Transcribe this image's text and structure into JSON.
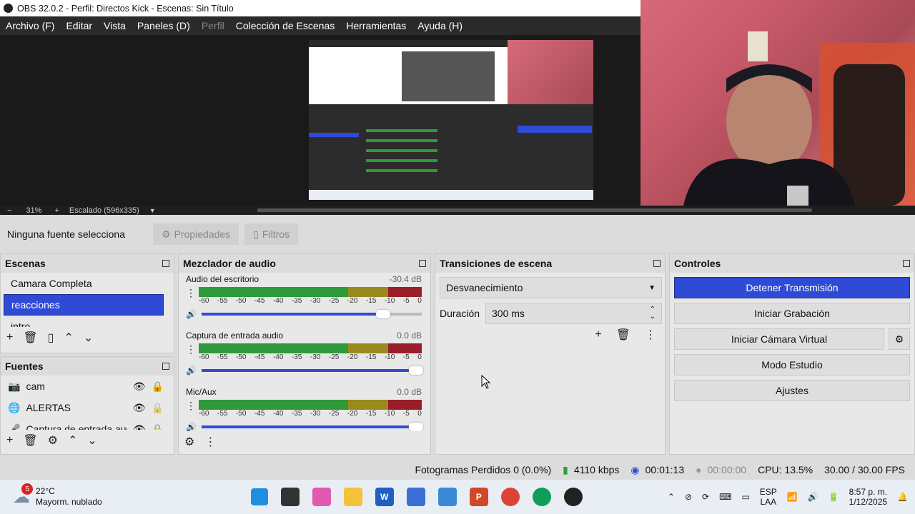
{
  "window": {
    "title": "OBS 32.0.2 - Perfil: Directos Kick - Escenas: Sin Título"
  },
  "menu": [
    {
      "label": "Archivo (F)",
      "disabled": false
    },
    {
      "label": "Editar",
      "disabled": false
    },
    {
      "label": "Vista",
      "disabled": false
    },
    {
      "label": "Paneles (D)",
      "disabled": false
    },
    {
      "label": "Perfil",
      "disabled": true
    },
    {
      "label": "Colección de Escenas",
      "disabled": false
    },
    {
      "label": "Herramientas",
      "disabled": false
    },
    {
      "label": "Ayuda (H)",
      "disabled": false
    }
  ],
  "zoom": {
    "minus": "−",
    "percent": "31%",
    "plus": "+",
    "scaling": "Escalado (596x335)"
  },
  "source_toolbar": {
    "no_source": "Ninguna fuente selecciona",
    "properties": "Propiedades",
    "filters": "Filtros"
  },
  "scenes": {
    "title": "Escenas",
    "items": [
      {
        "label": "Camara Completa",
        "selected": false
      },
      {
        "label": "reacciones",
        "selected": true
      },
      {
        "label": "intro",
        "selected": false
      }
    ]
  },
  "sources": {
    "title": "Fuentes",
    "items": [
      {
        "label": "cam",
        "icon": "camera-icon"
      },
      {
        "label": "ALERTAS",
        "icon": "globe-icon"
      },
      {
        "label": "Captura de entrada aud",
        "icon": "mic-icon"
      }
    ]
  },
  "mixer": {
    "title": "Mezclador de audio",
    "scale": [
      "-60",
      "-55",
      "-50",
      "-45",
      "-40",
      "-35",
      "-30",
      "-25",
      "-20",
      "-15",
      "-10",
      "-5",
      "0"
    ],
    "channels": [
      {
        "name": "Audio del escritorio",
        "db": "-30.4 dB",
        "volume": 0.85
      },
      {
        "name": "Captura de entrada audio",
        "db": "0.0 dB",
        "volume": 1.0
      },
      {
        "name": "Mic/Aux",
        "db": "0.0 dB",
        "volume": 1.0
      }
    ]
  },
  "transitions": {
    "title": "Transiciones de escena",
    "selected": "Desvanecimiento",
    "duration_label": "Duración",
    "duration_value": "300 ms"
  },
  "controls": {
    "title": "Controles",
    "buttons": {
      "stop_stream": "Detener Transmisión",
      "start_record": "Iniciar Grabación",
      "start_vcam": "Iniciar Cámara Virtual",
      "studio": "Modo Estudio",
      "settings": "Ajustes"
    }
  },
  "status": {
    "dropped": "Fotogramas Perdidos 0 (0.0%)",
    "bitrate": "4110 kbps",
    "stream_time": "00:01:13",
    "record_time": "00:00:00",
    "cpu": "CPU: 13.5%",
    "fps": "30.00 / 30.00 FPS"
  },
  "taskbar": {
    "weather_temp": "22°C",
    "weather_desc": "Mayorm. nublado",
    "weather_badge": "5",
    "lang1": "ESP",
    "lang2": "LAA",
    "time": "8:57 p. m.",
    "date": "1/12/2025"
  },
  "colors": {
    "accent": "#2f4bd6",
    "meter_green": "#2e9a3a",
    "meter_yellow": "#9a8a1e",
    "meter_red": "#9a1e2a"
  }
}
